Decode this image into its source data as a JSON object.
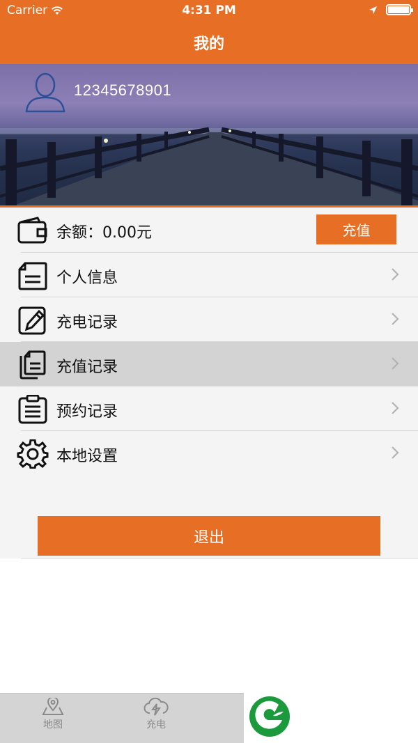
{
  "status_bar": {
    "carrier": "Carrier",
    "time": "4:31 PM"
  },
  "nav": {
    "title": "我的"
  },
  "profile": {
    "account": "12345678901"
  },
  "balance": {
    "label": "余额：0.00元",
    "recharge_button": "充值"
  },
  "menu": {
    "items": [
      {
        "label": "个人信息",
        "icon": "profile-document-icon"
      },
      {
        "label": "充电记录",
        "icon": "edit-document-icon"
      },
      {
        "label": "充值记录",
        "icon": "copy-document-icon",
        "selected": true
      },
      {
        "label": "预约记录",
        "icon": "clipboard-icon"
      },
      {
        "label": "本地设置",
        "icon": "gear-icon"
      }
    ]
  },
  "logout_button": "退出",
  "tabbar": {
    "tabs": [
      {
        "label": "地图",
        "icon": "map-pin-icon"
      },
      {
        "label": "充电",
        "icon": "cloud-charge-icon"
      }
    ]
  },
  "colors": {
    "accent": "#e76f25",
    "selected_row": "#d3d3d3",
    "menu_bg": "#f4f4f4",
    "logo_green": "#1a9a3c"
  }
}
